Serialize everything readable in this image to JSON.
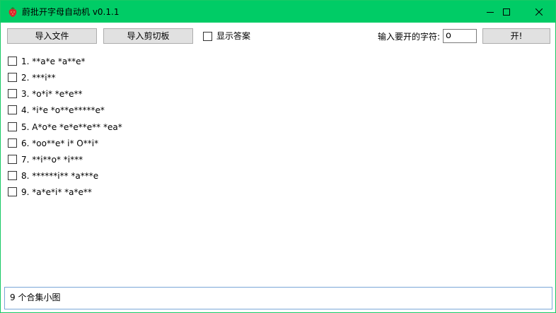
{
  "window": {
    "title": "蔚批开字母自动机 v0.1.1",
    "accent": "#00cc66",
    "controls": [
      "minimize-icon",
      "maximize-icon",
      "close-icon"
    ]
  },
  "toolbar": {
    "import_file_label": "导入文件",
    "import_clipboard_label": "导入剪切板",
    "show_answers_label": "显示答案",
    "show_answers_checked": false,
    "char_input_label": "输入要开的字符:",
    "char_input_value": "o",
    "open_label": "开!"
  },
  "items": [
    {
      "label": "1. **a*e *a**e*",
      "checked": false
    },
    {
      "label": "2. ***i**",
      "checked": false
    },
    {
      "label": "3. *o*i* *e*e**",
      "checked": false
    },
    {
      "label": "4. *i*e *o**e*****e*",
      "checked": false
    },
    {
      "label": "5. A*o*e *e*e**e** *ea*",
      "checked": false
    },
    {
      "label": "6. *oo**e* i* O**i*",
      "checked": false
    },
    {
      "label": "7. **i**o* *i***",
      "checked": false
    },
    {
      "label": "8. ******i** *a***e",
      "checked": false
    },
    {
      "label": "9. *a*e*i* *a*e**",
      "checked": false
    }
  ],
  "status": {
    "text": "9 个合集小图"
  }
}
